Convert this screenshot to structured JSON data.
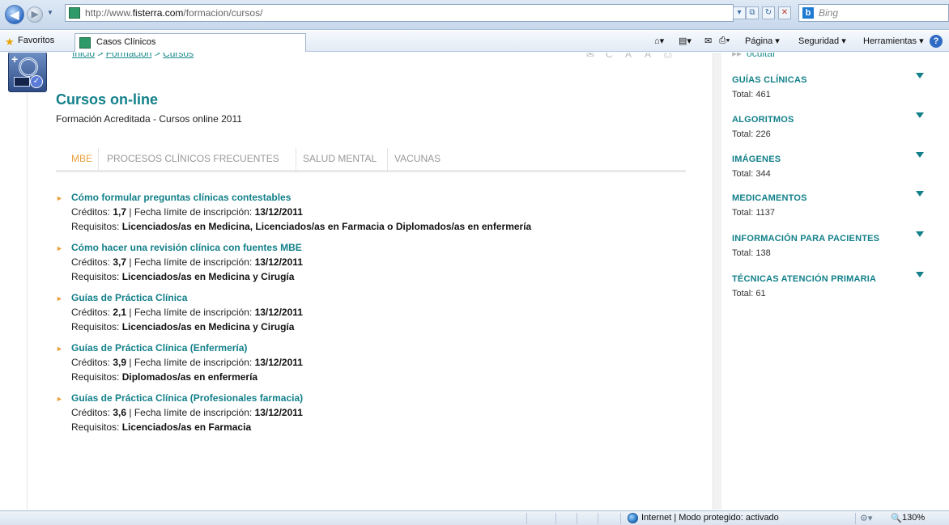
{
  "browser": {
    "url_prefix": "http://www.",
    "url_domain": "fisterra.com",
    "url_path": "/formacion/cursos/",
    "search_placeholder": "Bing",
    "favorites_label": "Favoritos",
    "tab_title": "Casos Clínicos",
    "commands": [
      "Página ▾",
      "Seguridad ▾",
      "Herramientas ▾"
    ]
  },
  "page": {
    "breadcrumb": [
      {
        "label": "Inicio"
      },
      {
        "label": "Formación"
      },
      {
        "label": "Cursos"
      }
    ],
    "breadcrumb_sep": " > ",
    "toolbar_glyphs": [
      "✉",
      "C",
      "A",
      "A",
      "⎙"
    ],
    "title": "Cursos on-line",
    "subtitle": "Formación Acreditada - Cursos online 2011",
    "tabs": [
      "MBE",
      "PROCESOS CLÍNICOS FRECUENTES",
      "SALUD MENTAL",
      "VACUNAS"
    ],
    "active_tab": "MBE",
    "credits_label": "Créditos: ",
    "deadline_label": " | Fecha límite de inscripción: ",
    "requirements_label": "Requisitos: ",
    "courses": [
      {
        "title": "Cómo formular preguntas clínicas contestables",
        "credits": "1,7",
        "deadline": "13/12/2011",
        "requirements": "Licenciados/as en Medicina, Licenciados/as en Farmacia o Diplomados/as en enfermería"
      },
      {
        "title": "Cómo hacer una revisión clínica con fuentes MBE",
        "credits": "3,7",
        "deadline": "13/12/2011",
        "requirements": "Licenciados/as en Medicina y Cirugía"
      },
      {
        "title": "Guías de Práctica Clínica",
        "credits": "2,1",
        "deadline": "13/12/2011",
        "requirements": "Licenciados/as en Medicina y Cirugía"
      },
      {
        "title": "Guías de Práctica Clínica (Enfermería)",
        "credits": "3,9",
        "deadline": "13/12/2011",
        "requirements": "Diplomados/as en enfermería"
      },
      {
        "title": "Guías de Práctica Clínica (Profesionales farmacia)",
        "credits": "3,6",
        "deadline": "13/12/2011",
        "requirements": "Licenciados/as en Farmacia"
      }
    ]
  },
  "sidebar": {
    "hide_label": "ocultar",
    "categories": [
      {
        "title": "GUÍAS CLÍNICAS",
        "total": "Total: 461"
      },
      {
        "title": "ALGORITMOS",
        "total": "Total: 226"
      },
      {
        "title": "IMÁGENES",
        "total": "Total: 344"
      },
      {
        "title": "MEDICAMENTOS",
        "total": "Total: 1137"
      },
      {
        "title": "INFORMACIÓN PARA PACIENTES",
        "total": "Total: 138"
      },
      {
        "title": "TÉCNICAS ATENCIÓN PRIMARIA",
        "total": "Total: 61"
      }
    ]
  },
  "status": {
    "zone": "Internet | Modo protegido: activado",
    "zoom": "130%"
  },
  "colors": {
    "brand_teal": "#13808a",
    "accent_orange": "#e8a13c"
  }
}
